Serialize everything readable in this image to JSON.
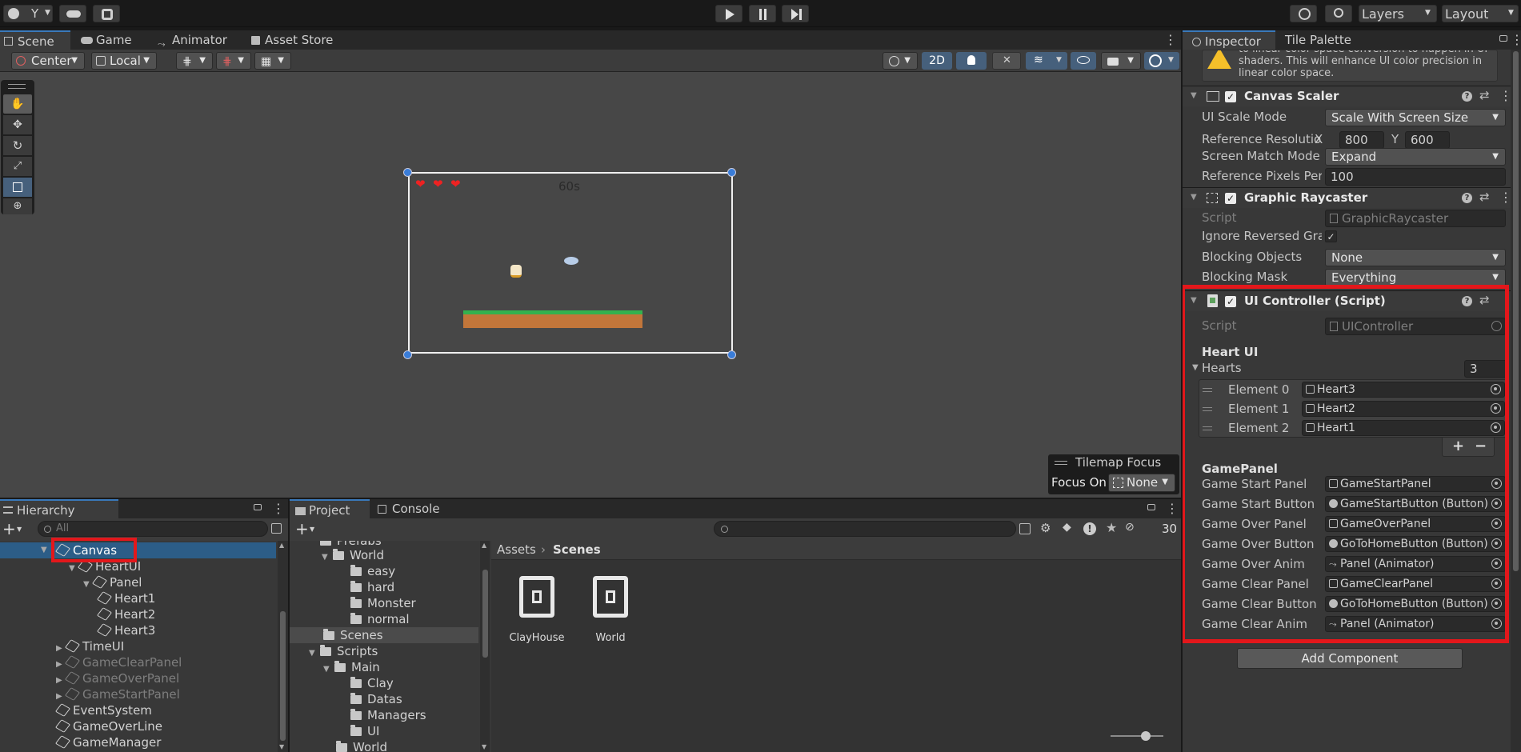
{
  "toolbar": {
    "account_label": "Y",
    "layers_label": "Layers",
    "layout_label": "Layout"
  },
  "scene_tabs": [
    {
      "label": "Scene"
    },
    {
      "label": "Game"
    },
    {
      "label": "Animator"
    },
    {
      "label": "Asset Store"
    }
  ],
  "scene_toolbar": {
    "pivot_label": "Center",
    "space_label": "Local",
    "mode_2d_label": "2D"
  },
  "game_view": {
    "timer_text": "60s",
    "hearts_count": 3
  },
  "tilemap_focus": {
    "title": "Tilemap Focus",
    "focus_label": "Focus On",
    "focus_value": "None"
  },
  "hierarchy": {
    "tab_label": "Hierarchy",
    "search_placeholder": "All",
    "items": [
      {
        "label": "Canvas",
        "selected": true,
        "dim": false
      },
      {
        "label": "HeartUI",
        "dim": false
      },
      {
        "label": "Panel",
        "dim": false
      },
      {
        "label": "Heart1",
        "dim": false
      },
      {
        "label": "Heart2",
        "dim": false
      },
      {
        "label": "Heart3",
        "dim": false
      },
      {
        "label": "TimeUI",
        "dim": false
      },
      {
        "label": "GameClearPanel",
        "dim": true
      },
      {
        "label": "GameOverPanel",
        "dim": true
      },
      {
        "label": "GameStartPanel",
        "dim": true
      },
      {
        "label": "EventSystem",
        "dim": false
      },
      {
        "label": "GameOverLine",
        "dim": false
      },
      {
        "label": "GameManager",
        "dim": false
      }
    ]
  },
  "project": {
    "tabs": [
      {
        "label": "Project"
      },
      {
        "label": "Console"
      }
    ],
    "hidden_count": "30",
    "folders": [
      {
        "label": "Prefabs"
      },
      {
        "label": "World"
      },
      {
        "label": "easy"
      },
      {
        "label": "hard"
      },
      {
        "label": "Monster"
      },
      {
        "label": "normal"
      },
      {
        "label": "Scenes"
      },
      {
        "label": "Scripts"
      },
      {
        "label": "Main"
      },
      {
        "label": "Clay"
      },
      {
        "label": "Datas"
      },
      {
        "label": "Managers"
      },
      {
        "label": "UI"
      },
      {
        "label": "World"
      }
    ],
    "breadcrumb": {
      "root": "Assets",
      "current": "Scenes"
    },
    "assets": [
      {
        "label": "ClayHouse"
      },
      {
        "label": "World"
      }
    ]
  },
  "inspector": {
    "tabs": [
      {
        "label": "Inspector"
      },
      {
        "label": "Tile Palette"
      }
    ],
    "warning_text": "to linear color space conversion to happen in UI shaders. This will enhance UI color precision in linear color space.",
    "canvas_scaler": {
      "title": "Canvas Scaler",
      "ui_scale_mode_label": "UI Scale Mode",
      "ui_scale_mode_value": "Scale With Screen Size",
      "ref_res_label": "Reference Resolutior",
      "ref_x_label": "X",
      "ref_x_value": "800",
      "ref_y_label": "Y",
      "ref_y_value": "600",
      "match_mode_label": "Screen Match Mode",
      "match_mode_value": "Expand",
      "ref_pixels_label": "Reference Pixels Per",
      "ref_pixels_value": "100"
    },
    "graphic_raycaster": {
      "title": "Graphic Raycaster",
      "script_label": "Script",
      "script_value": "GraphicRaycaster",
      "ignore_label": "Ignore Reversed Grap",
      "blocking_objects_label": "Blocking Objects",
      "blocking_objects_value": "None",
      "blocking_mask_label": "Blocking Mask",
      "blocking_mask_value": "Everything"
    },
    "ui_controller": {
      "title": "UI Controller (Script)",
      "script_label": "Script",
      "script_value": "UIController",
      "heart_ui_header": "Heart UI",
      "hearts_label": "Hearts",
      "hearts_size": "3",
      "elements": [
        {
          "label": "Element 0",
          "value": "Heart3"
        },
        {
          "label": "Element 1",
          "value": "Heart2"
        },
        {
          "label": "Element 2",
          "value": "Heart1"
        }
      ],
      "game_panel_header": "GamePanel",
      "fields": [
        {
          "label": "Game Start Panel",
          "value": "GameStartPanel",
          "kind": "cube"
        },
        {
          "label": "Game Start Button",
          "value": "GameStartButton (Button)",
          "kind": "comp"
        },
        {
          "label": "Game Over Panel",
          "value": "GameOverPanel",
          "kind": "cube"
        },
        {
          "label": "Game Over Button",
          "value": "GoToHomeButton (Button)",
          "kind": "comp"
        },
        {
          "label": "Game Over Anim",
          "value": "Panel (Animator)",
          "kind": "anim"
        },
        {
          "label": "Game Clear Panel",
          "value": "GameClearPanel",
          "kind": "cube"
        },
        {
          "label": "Game Clear Button",
          "value": "GoToHomeButton (Button)",
          "kind": "comp"
        },
        {
          "label": "Game Clear Anim",
          "value": "Panel (Animator)",
          "kind": "anim"
        }
      ]
    },
    "add_component_label": "Add Component"
  },
  "colors": {
    "highlight_red": "#e3171b",
    "selection_blue": "#2c5d87",
    "bg_panel": "#383838"
  }
}
